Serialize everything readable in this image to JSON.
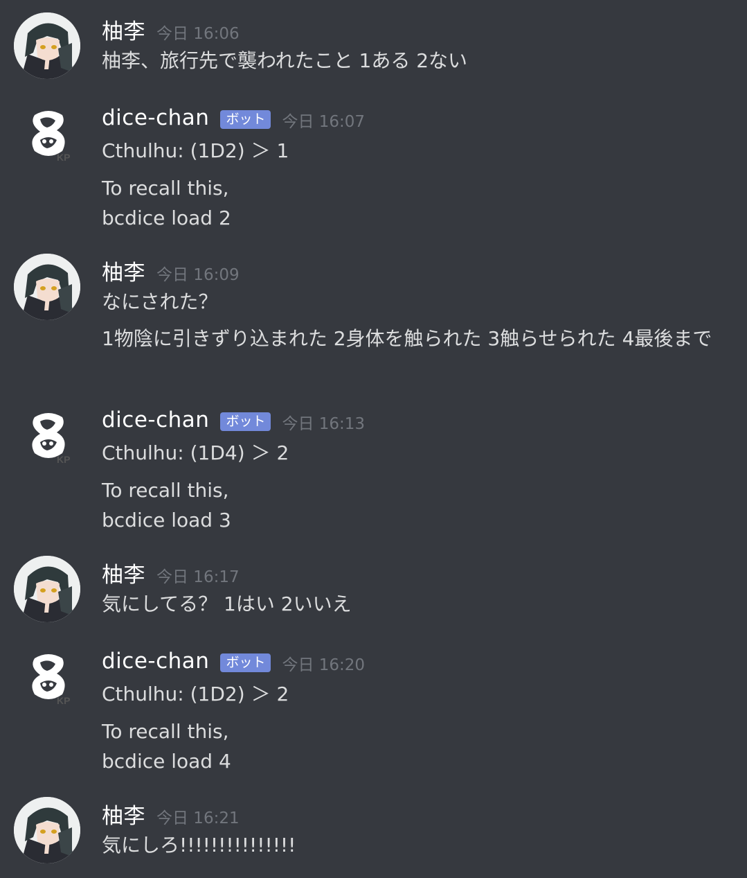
{
  "messages": [
    {
      "author": "柚李",
      "is_bot": false,
      "timestamp": "今日 16:06",
      "lines": [
        "柚李、旅行先で襲われたこと 1ある 2ない"
      ]
    },
    {
      "author": "dice-chan",
      "is_bot": true,
      "badge": "ボット",
      "timestamp": "今日 16:07",
      "lines": [
        "Cthulhu: (1D2) ＞ 1",
        "To recall this,",
        "bcdice load 2"
      ]
    },
    {
      "author": "柚李",
      "is_bot": false,
      "timestamp": "今日 16:09",
      "lines": [
        "なにされた？",
        "1物陰に引きずり込まれた 2身体を触られた 3触らせられた 4最後まで"
      ]
    },
    {
      "author": "dice-chan",
      "is_bot": true,
      "badge": "ボット",
      "timestamp": "今日 16:13",
      "lines": [
        "Cthulhu: (1D4) ＞ 2",
        "To recall this,",
        "bcdice load 3"
      ]
    },
    {
      "author": "柚李",
      "is_bot": false,
      "timestamp": "今日 16:17",
      "lines": [
        "気にしてる？ 1はい 2いいえ"
      ]
    },
    {
      "author": "dice-chan",
      "is_bot": true,
      "badge": "ボット",
      "timestamp": "今日 16:20",
      "lines": [
        "Cthulhu: (1D2) ＞ 2",
        "To recall this,",
        "bcdice load 4"
      ]
    },
    {
      "author": "柚李",
      "is_bot": false,
      "timestamp": "今日 16:21",
      "lines": [
        "気にしろ!!!!!!!!!!!!!!!"
      ]
    }
  ],
  "colors": {
    "background": "#36393f",
    "text": "#dcddde",
    "username": "#ffffff",
    "timestamp": "#72767d",
    "bot_badge": "#7289da"
  },
  "icons": {
    "user_avatar": "anime-character-avatar-icon",
    "bot_avatar": "dice-chan-logo-icon"
  }
}
